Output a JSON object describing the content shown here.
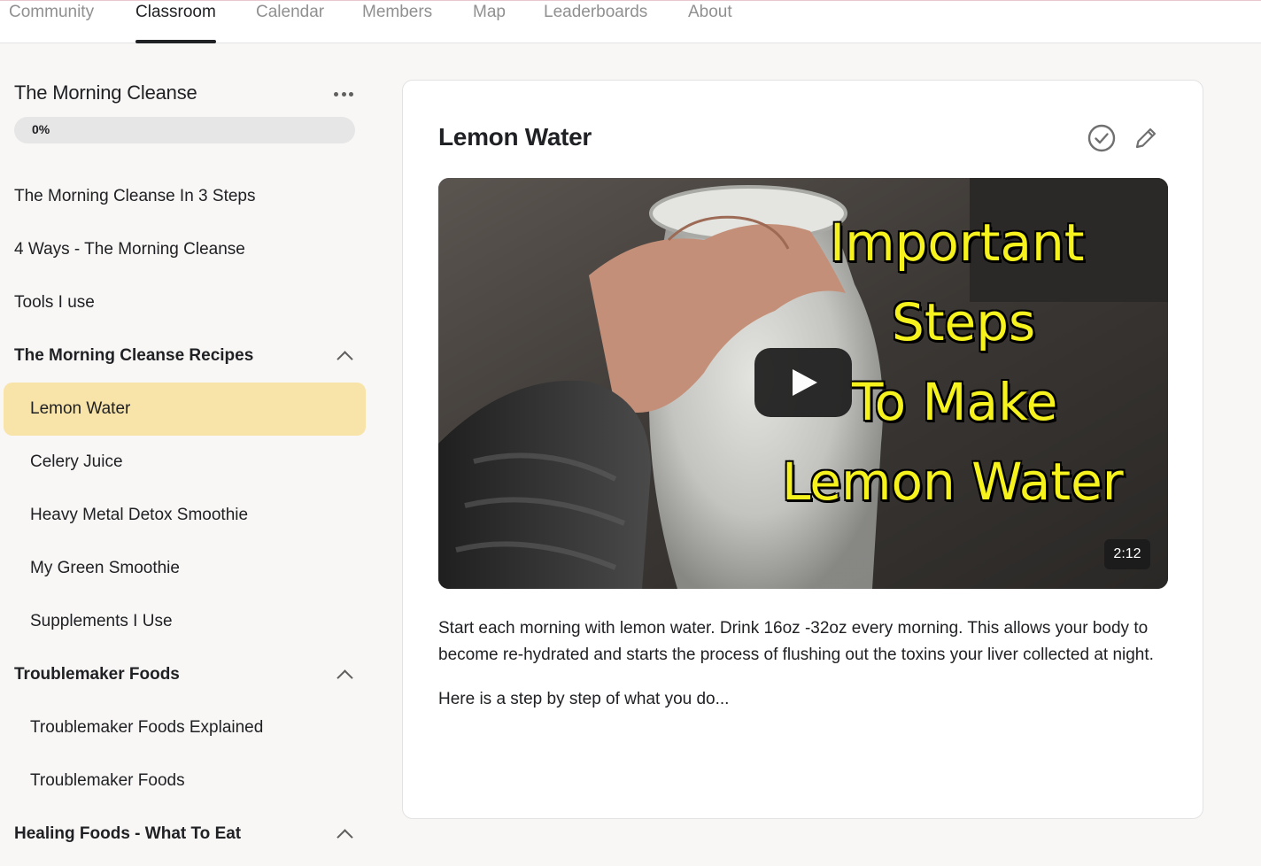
{
  "nav": {
    "tabs": [
      {
        "label": "Community"
      },
      {
        "label": "Classroom",
        "active": true
      },
      {
        "label": "Calendar"
      },
      {
        "label": "Members"
      },
      {
        "label": "Map"
      },
      {
        "label": "Leaderboards"
      },
      {
        "label": "About"
      }
    ]
  },
  "sidebar": {
    "course_title": "The Morning Cleanse",
    "more_icon": "more-horizontal-icon",
    "progress": {
      "label": "0%",
      "value": 0
    },
    "items": [
      {
        "label": "The Morning Cleanse In 3 Steps",
        "kind": "top"
      },
      {
        "label": "4 Ways - The Morning Cleanse",
        "kind": "top"
      },
      {
        "label": "Tools I use",
        "kind": "top"
      },
      {
        "label": "The Morning Cleanse Recipes",
        "kind": "section",
        "expanded": true
      },
      {
        "label": "Lemon Water",
        "kind": "sub",
        "active": true
      },
      {
        "label": "Celery Juice",
        "kind": "sub"
      },
      {
        "label": "Heavy Metal Detox Smoothie",
        "kind": "sub"
      },
      {
        "label": "My Green Smoothie",
        "kind": "sub"
      },
      {
        "label": "Supplements I Use",
        "kind": "sub"
      },
      {
        "label": "Troublemaker Foods",
        "kind": "section",
        "expanded": true
      },
      {
        "label": "Troublemaker Foods Explained",
        "kind": "sub"
      },
      {
        "label": "Troublemaker Foods",
        "kind": "sub"
      },
      {
        "label": "Healing Foods - What To Eat",
        "kind": "section",
        "expanded": true
      }
    ]
  },
  "lesson": {
    "title": "Lemon Water",
    "icons": {
      "complete": "check-circle-icon",
      "edit": "pencil-icon"
    },
    "video": {
      "thumbnail_lines": [
        "Important",
        "Steps",
        "To Make",
        "Lemon Water"
      ],
      "duration": "2:12"
    },
    "paragraphs": [
      "Start each morning with lemon water. Drink 16oz -32oz every morning. This allows your body to become re-hydrated and starts the process of flushing out the toxins your liver collected at night.",
      "Here is a step by step of what you do..."
    ]
  },
  "colors": {
    "active_item_bg": "#f8e4a9",
    "thumb_text": "#f6f21d",
    "page_bg": "#f8f7f5"
  }
}
